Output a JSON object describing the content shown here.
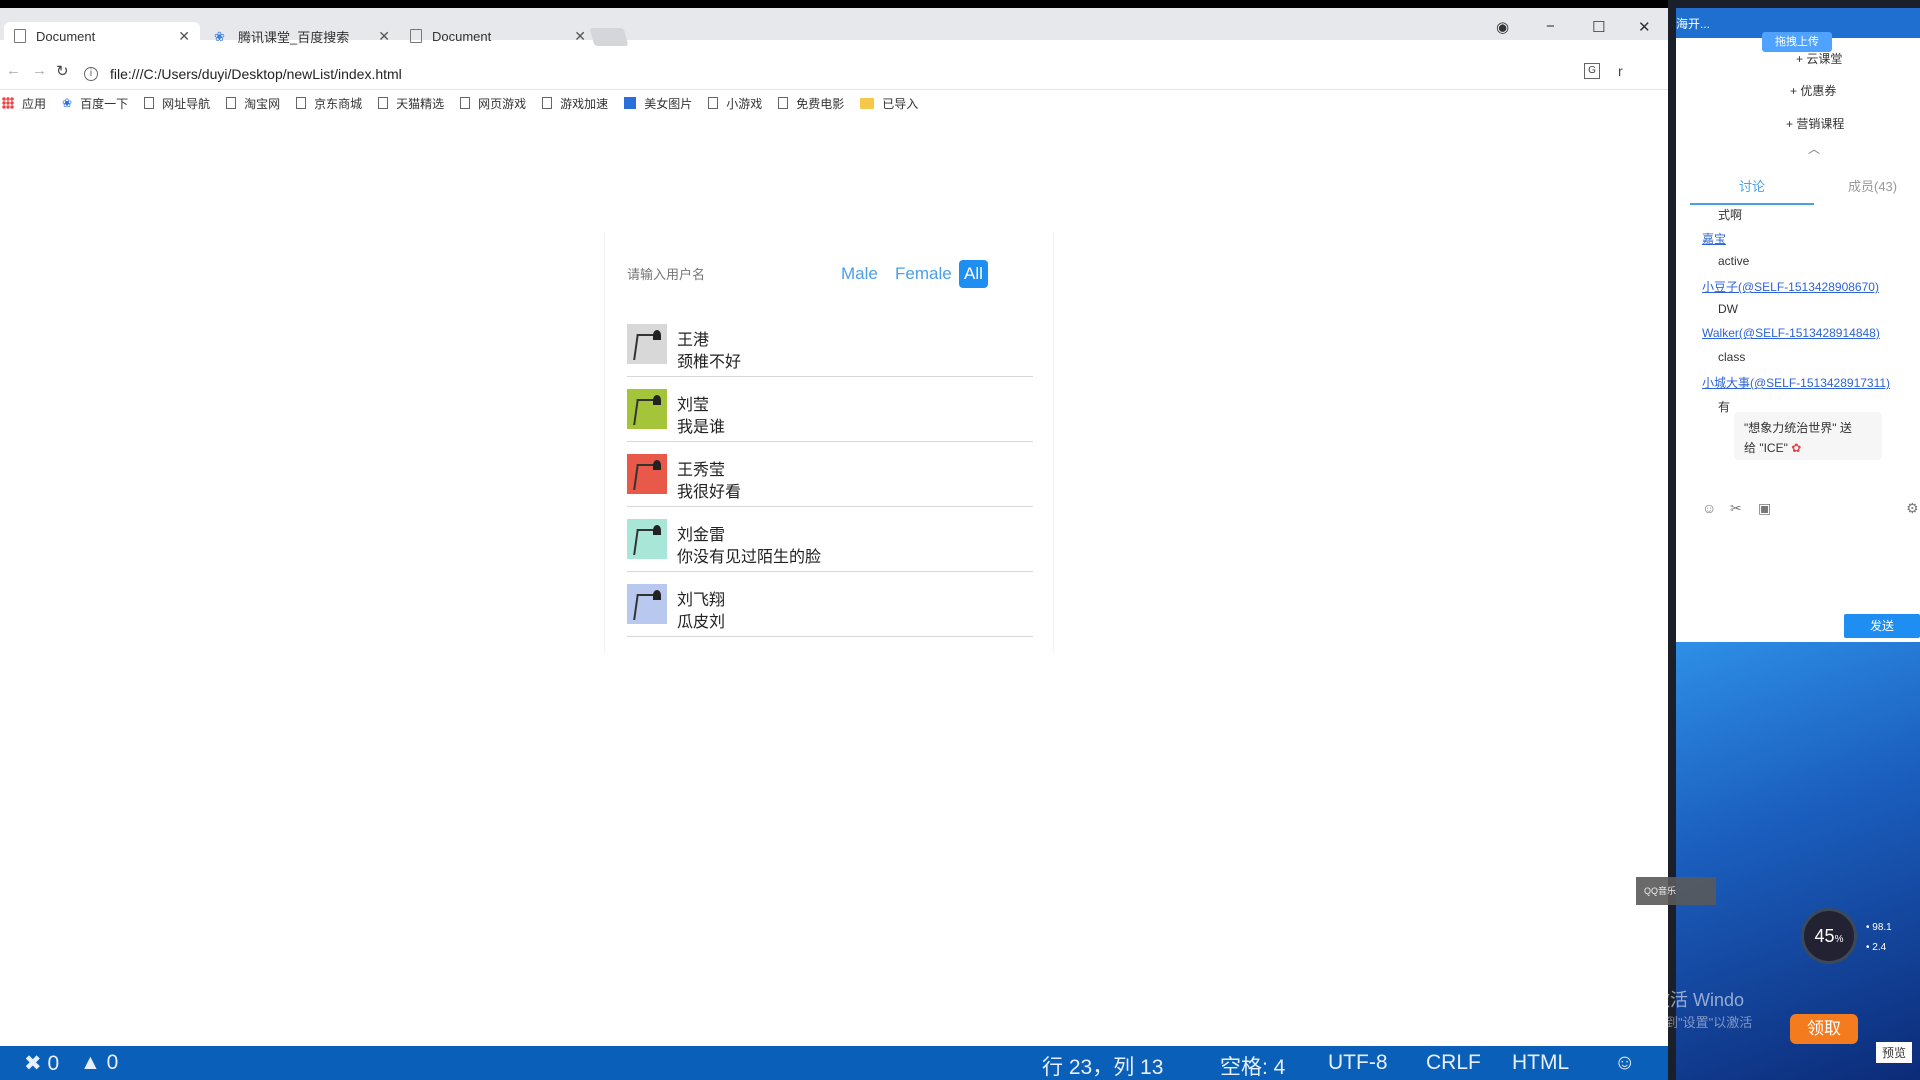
{
  "browser": {
    "tabs": [
      {
        "title": "Document",
        "active": true
      },
      {
        "title": "腾讯课堂_百度搜索",
        "active": false
      },
      {
        "title": "Document",
        "active": false
      }
    ],
    "url": "file:///C:/Users/duyi/Desktop/newList/index.html",
    "bookmarks": [
      "应用",
      "百度一下",
      "网址导航",
      "淘宝网",
      "京东商城",
      "天猫精选",
      "网页游戏",
      "游戏加速",
      "美女图片",
      "小游戏",
      "免费电影",
      "已导入"
    ],
    "window_controls": {
      "account": "◉",
      "minimize": "−",
      "maximize": "☐",
      "close": "✕"
    }
  },
  "app": {
    "search_placeholder": "请输入用户名",
    "filters": [
      "Male",
      "Female",
      "All"
    ],
    "active_filter": "All",
    "users": [
      {
        "name": "王港",
        "desc": "颈椎不好",
        "avatar_color": "#d8d8d8"
      },
      {
        "name": "刘莹",
        "desc": "我是谁",
        "avatar_color": "#a4c53a"
      },
      {
        "name": "王秀莹",
        "desc": "我很好看",
        "avatar_color": "#e8594a"
      },
      {
        "name": "刘金雷",
        "desc": "你没有见过陌生的脸",
        "avatar_color": "#a8e6d8"
      },
      {
        "name": "刘飞翔",
        "desc": "瓜皮刘",
        "avatar_color": "#b9c8ef"
      }
    ]
  },
  "statusbar": {
    "errors": "0",
    "warnings": "0",
    "position": "行 23，列 13",
    "indent": "空格: 4",
    "encoding": "UTF-8",
    "eol": "CRLF",
    "language": "HTML",
    "smiley": "☺"
  },
  "side_panel": {
    "header_text": "海开...",
    "upload_label": "拖拽上传",
    "menu": [
      "+ 云课堂",
      "+ 优惠券",
      "+ 营销课程"
    ],
    "tabs": {
      "discuss": "讨论",
      "members": "成员(43)"
    },
    "chat": [
      {
        "type": "text",
        "text": "式啊"
      },
      {
        "type": "link",
        "text": "嘉宝"
      },
      {
        "type": "text",
        "text": "active"
      },
      {
        "type": "link",
        "text": "小豆子(@SELF-1513428908670)"
      },
      {
        "type": "text",
        "text": "DW"
      },
      {
        "type": "link",
        "text": "Walker(@SELF-1513428914848)"
      },
      {
        "type": "text",
        "text": "class"
      },
      {
        "type": "link",
        "text": "小城大事(@SELF-1513428917311)"
      },
      {
        "type": "text",
        "text": "有"
      }
    ],
    "gift_line1": "\"想象力统治世界\" 送",
    "gift_line2": "给 \"ICE\"",
    "send_label": "发送",
    "speed_value": "45",
    "speed_unit": "%",
    "net_up": "98.1",
    "net_down": "2.4",
    "claim_label": "领取",
    "activate_text": "激活 Windo",
    "activate_sub": "转到\"设置\"以激活",
    "preview_label": "预览",
    "music_tag": "QQ音乐"
  }
}
